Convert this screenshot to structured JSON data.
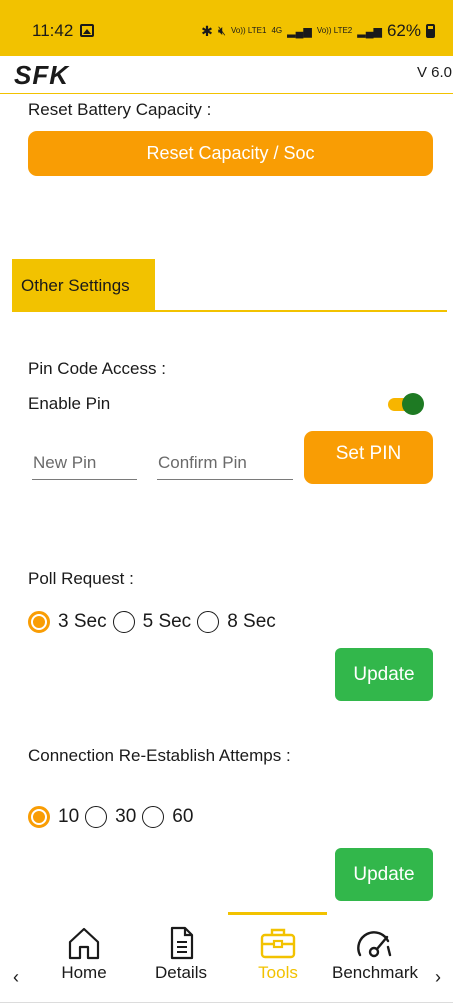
{
  "status_bar": {
    "time": "11:42",
    "signal_text_1": "Vo)) LTE1",
    "signal_text_2": "4G",
    "signal_text_3": "Vo)) LTE2",
    "battery": "62%"
  },
  "header": {
    "logo": "SFK",
    "version": "V 6.0"
  },
  "reset": {
    "label": "Reset Battery Capacity :",
    "button_label": "Reset Capacity / Soc"
  },
  "section": {
    "title": "Other Settings"
  },
  "pin": {
    "label": "Pin Code Access :",
    "enable_label": "Enable Pin",
    "enabled": true,
    "new_pin_placeholder": "New Pin",
    "confirm_pin_placeholder": "Confirm Pin",
    "set_button": "Set PIN"
  },
  "poll": {
    "label": "Poll Request :",
    "options": [
      "3 Sec",
      "5 Sec",
      "8 Sec"
    ],
    "selected": "3 Sec",
    "update_button": "Update"
  },
  "reconnect": {
    "label": "Connection Re-Establish Attemps :",
    "options": [
      "10",
      "30",
      "60"
    ],
    "selected": "10",
    "update_button": "Update"
  },
  "nav": {
    "prev_arrow": "‹",
    "next_arrow": "›",
    "items": [
      {
        "label": "Home",
        "icon": "home-icon"
      },
      {
        "label": "Details",
        "icon": "document-icon"
      },
      {
        "label": "Tools",
        "icon": "toolbox-icon"
      },
      {
        "label": "Benchmark",
        "icon": "speedometer-icon"
      }
    ],
    "active": "Tools"
  },
  "colors": {
    "brand_yellow": "#f2c200",
    "orange": "#f99d04",
    "green": "#32b74b",
    "toggle_thumb": "#1e7a23"
  }
}
